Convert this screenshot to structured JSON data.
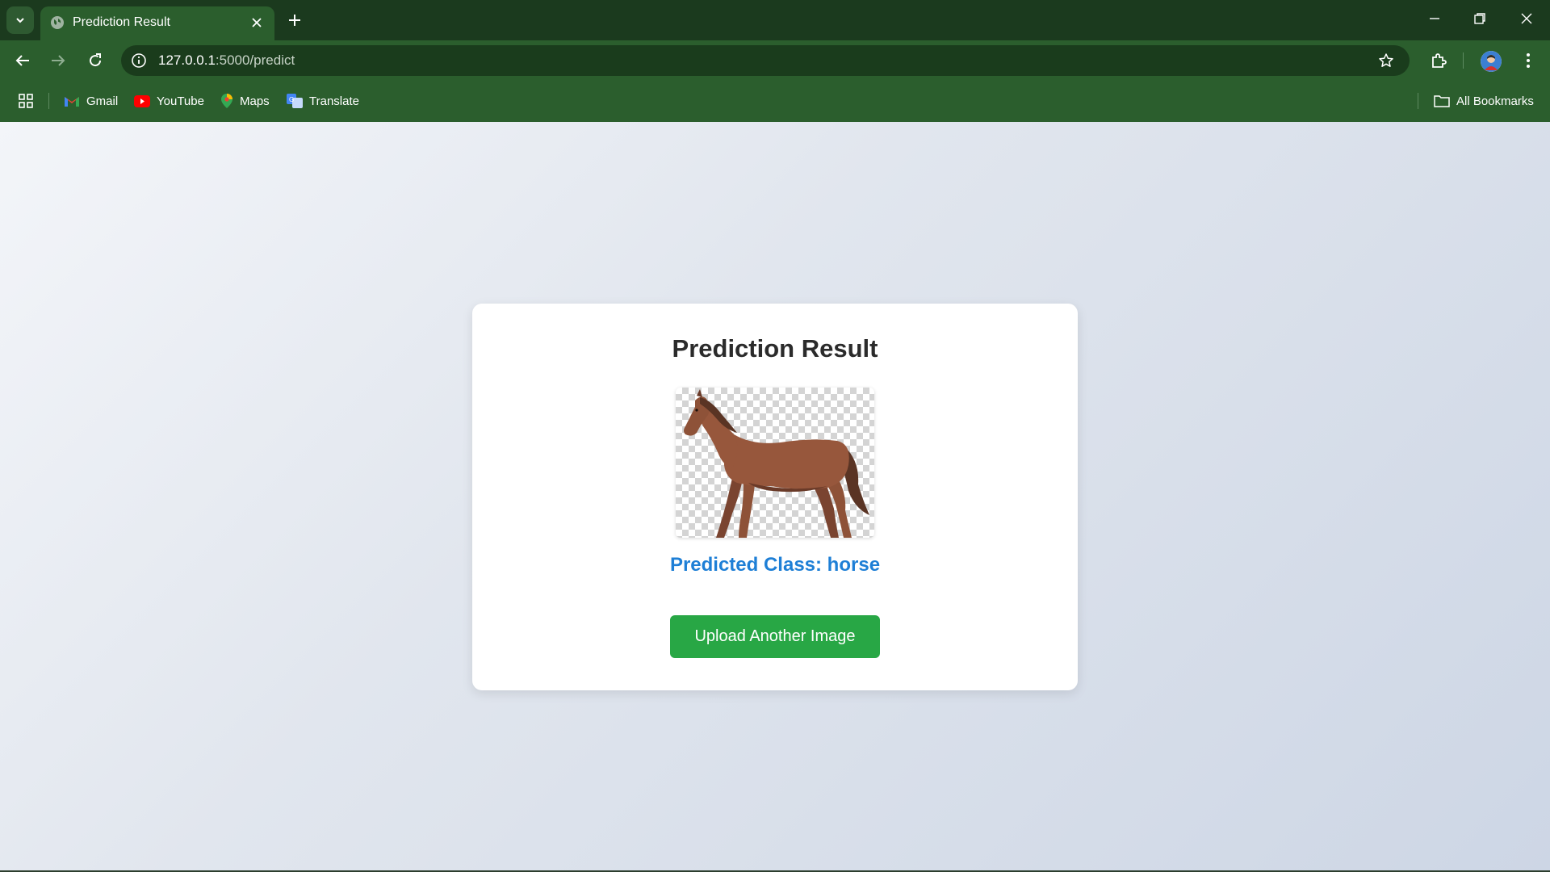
{
  "browser": {
    "tab": {
      "title": "Prediction Result"
    },
    "address": {
      "host": "127.0.0.1",
      "path": ":5000/predict"
    },
    "bookmarks": [
      {
        "label": "Gmail",
        "icon": "gmail-icon"
      },
      {
        "label": "YouTube",
        "icon": "youtube-icon"
      },
      {
        "label": "Maps",
        "icon": "maps-icon"
      },
      {
        "label": "Translate",
        "icon": "translate-icon"
      }
    ],
    "all_bookmarks_label": "All Bookmarks",
    "colors": {
      "chrome_dark": "#1b3a1e",
      "chrome": "#2b5e2d"
    }
  },
  "page": {
    "title": "Prediction Result",
    "image": {
      "subject": "horse",
      "background": "transparent-checkerboard"
    },
    "prediction_label": "Predicted Class: horse",
    "button_label": "Upload Another Image",
    "colors": {
      "accent_blue": "#1e7fd6",
      "button_green": "#28a745"
    }
  }
}
